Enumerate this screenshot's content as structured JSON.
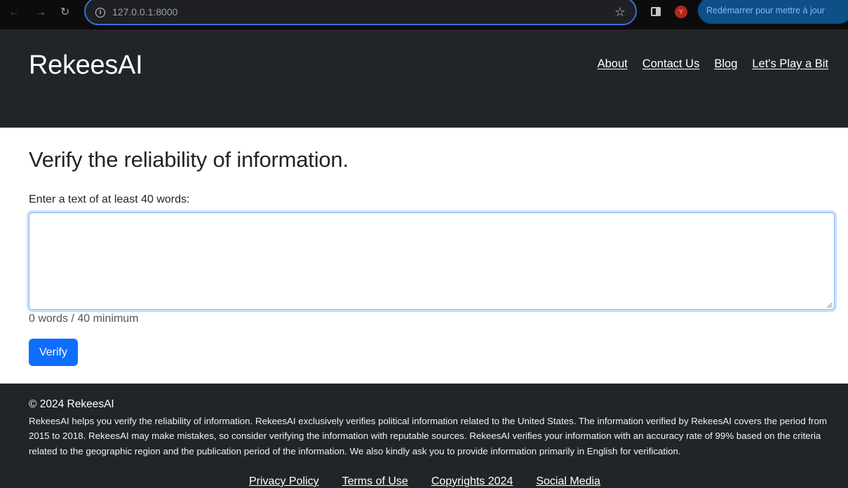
{
  "browser": {
    "url": "127.0.0.1:8000",
    "avatar_letter": "Y",
    "restart_label": "Redémarrer pour mettre à jour"
  },
  "header": {
    "brand": "RekeesAI",
    "nav": [
      "About",
      "Contact Us",
      "Blog",
      "Let's Play a Bit"
    ]
  },
  "main": {
    "title": "Verify the reliability of information.",
    "field_label": "Enter a text of at least 40 words:",
    "textarea_value": "",
    "word_count": "0 words / 40 minimum",
    "verify_label": "Verify"
  },
  "footer": {
    "copyright": "© 2024 RekeesAI",
    "disclaimer": "RekeesAI helps you verify the reliability of information. RekeesAI exclusively verifies political information related to the United States. The information verified by RekeesAI covers the period from 2015 to 2018. RekeesAI may make mistakes, so consider verifying the information with reputable sources. RekeesAI verifies your information with an accuracy rate of 99% based on the criteria related to the geographic region and the publication period of the information. We also kindly ask you to provide information primarily in English for verification.",
    "links": [
      "Privacy Policy",
      "Terms of Use",
      "Copyrights 2024",
      "Social Media"
    ]
  },
  "colors": {
    "header_bg": "#212529",
    "primary": "#0d6efd"
  }
}
